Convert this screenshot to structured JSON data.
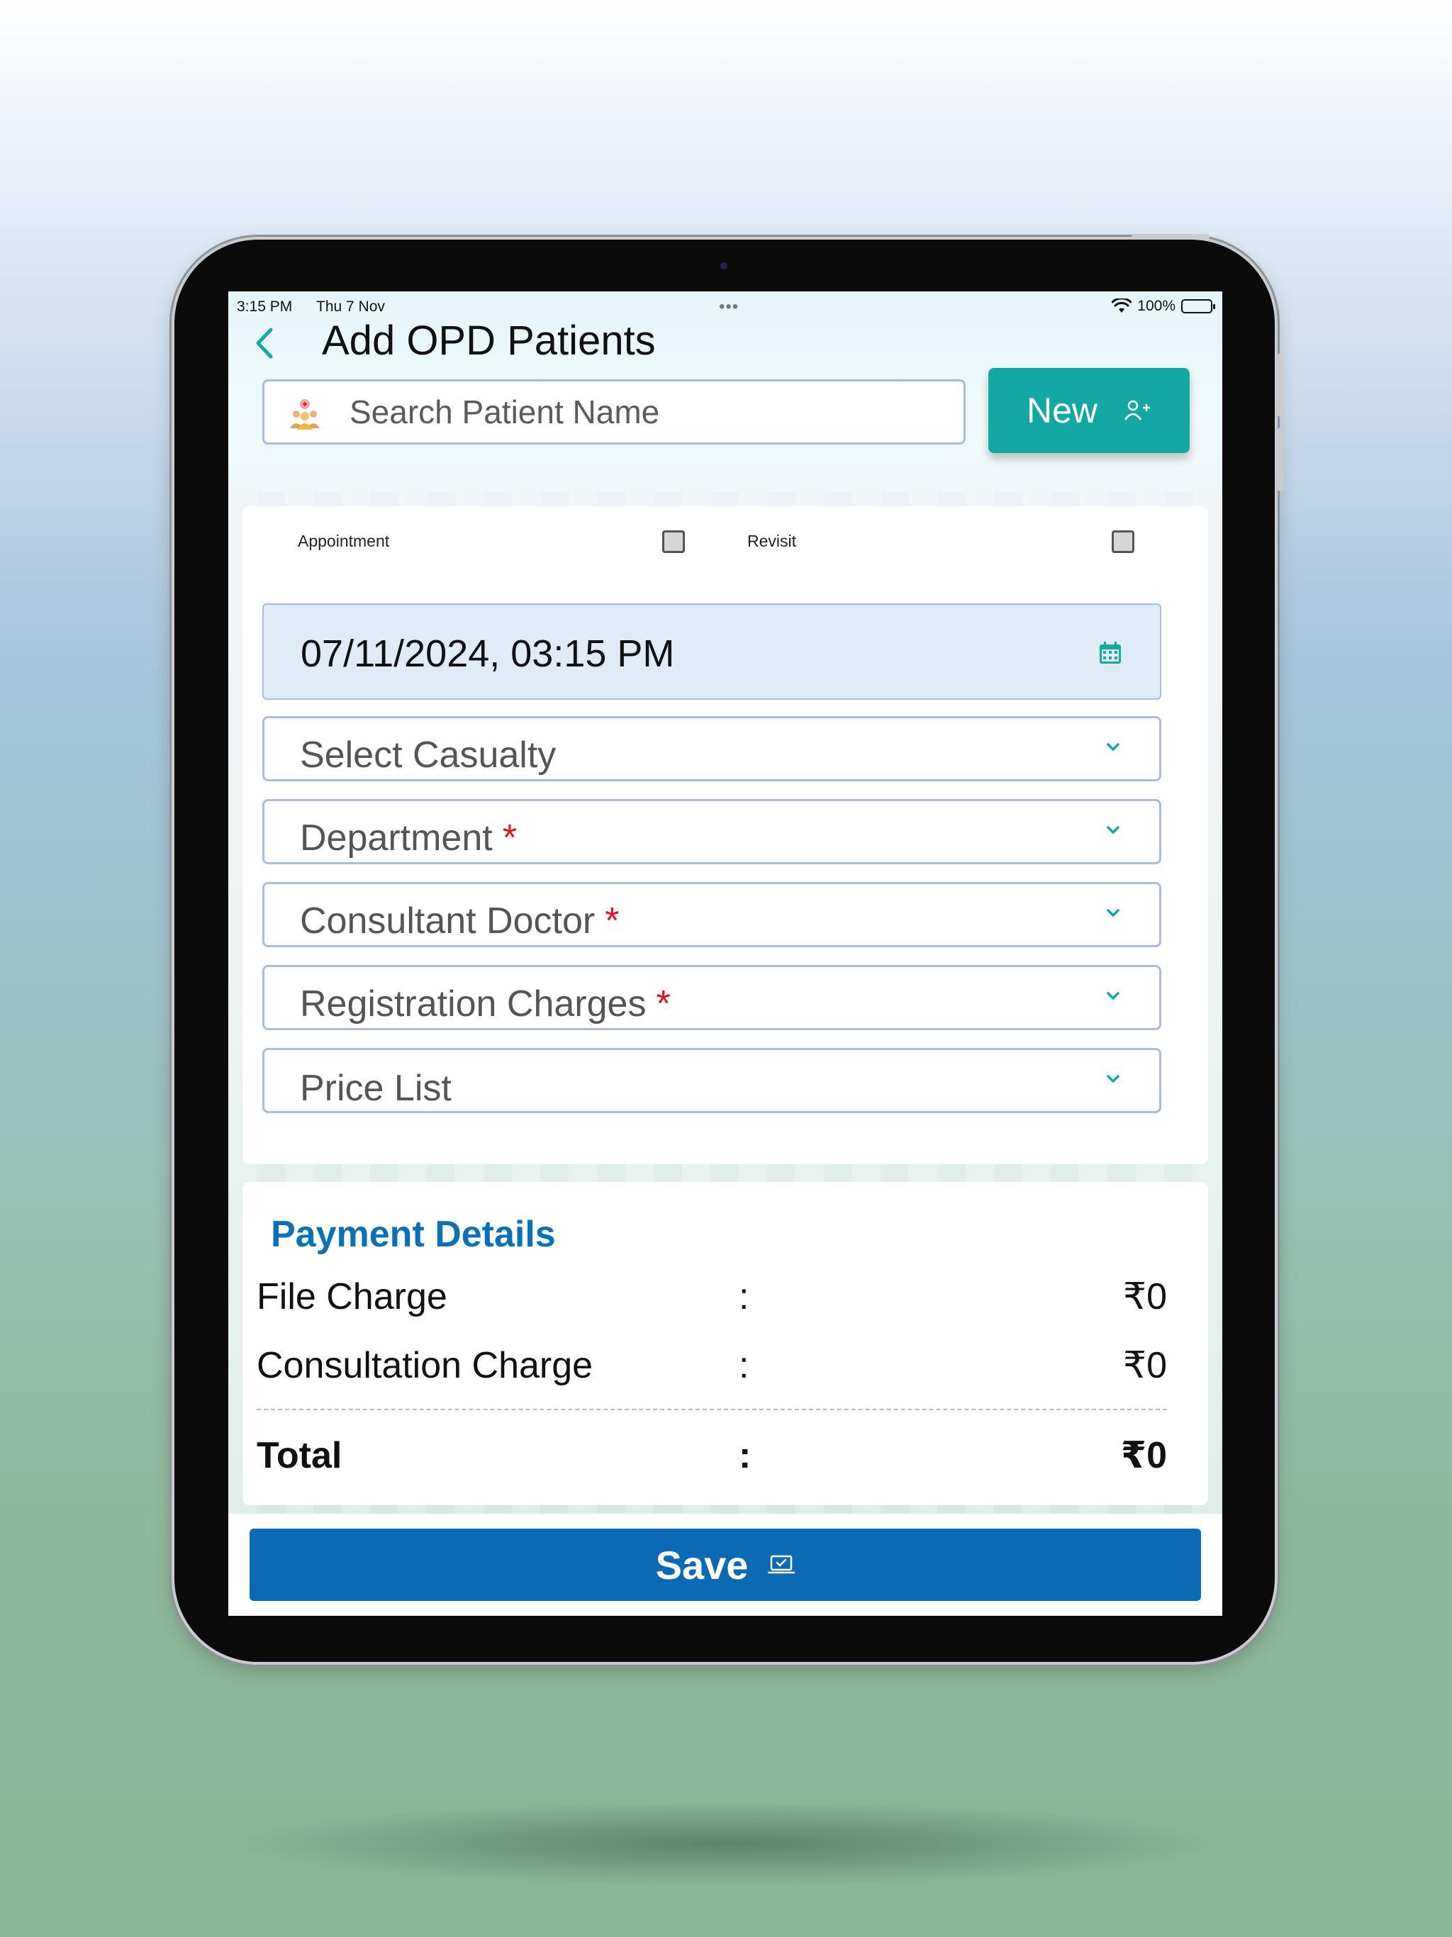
{
  "status_bar": {
    "time": "3:15 PM",
    "date": "Thu 7 Nov",
    "more": "•••",
    "battery": "100%"
  },
  "header": {
    "title": "Add OPD Patients",
    "back_icon": "chevron-left-icon"
  },
  "search": {
    "placeholder": "Search Patient Name",
    "icon": "patients-icon"
  },
  "new_button": {
    "label": "New",
    "icon": "add-user-icon"
  },
  "checkboxes": [
    {
      "label": "Appointment",
      "checked": false
    },
    {
      "label": "Revisit",
      "checked": false
    }
  ],
  "date_field": {
    "value": "07/11/2024, 03:15 PM",
    "icon": "calendar-icon"
  },
  "selects": [
    {
      "label": "Select Casualty",
      "required": false
    },
    {
      "label": "Department",
      "required": true,
      "required_mark": "*"
    },
    {
      "label": "Consultant Doctor",
      "required": true,
      "required_mark": "*"
    },
    {
      "label": "Registration Charges",
      "required": true,
      "required_mark": "*"
    },
    {
      "label": "Price List",
      "required": false
    }
  ],
  "payment": {
    "title": "Payment Details",
    "separator": ":",
    "rows": [
      {
        "label": "File Charge",
        "value": "₹0"
      },
      {
        "label": "Consultation Charge",
        "value": "₹0"
      }
    ],
    "total": {
      "label": "Total",
      "value": "₹0"
    }
  },
  "save_button": {
    "label": "Save",
    "icon": "laptop-check-icon"
  },
  "colors": {
    "accent_teal": "#14a8a2",
    "primary_blue": "#0a6ab4",
    "heading_blue": "#0a70b8",
    "required_red": "#e0141e",
    "field_border": "#a9bde0"
  }
}
